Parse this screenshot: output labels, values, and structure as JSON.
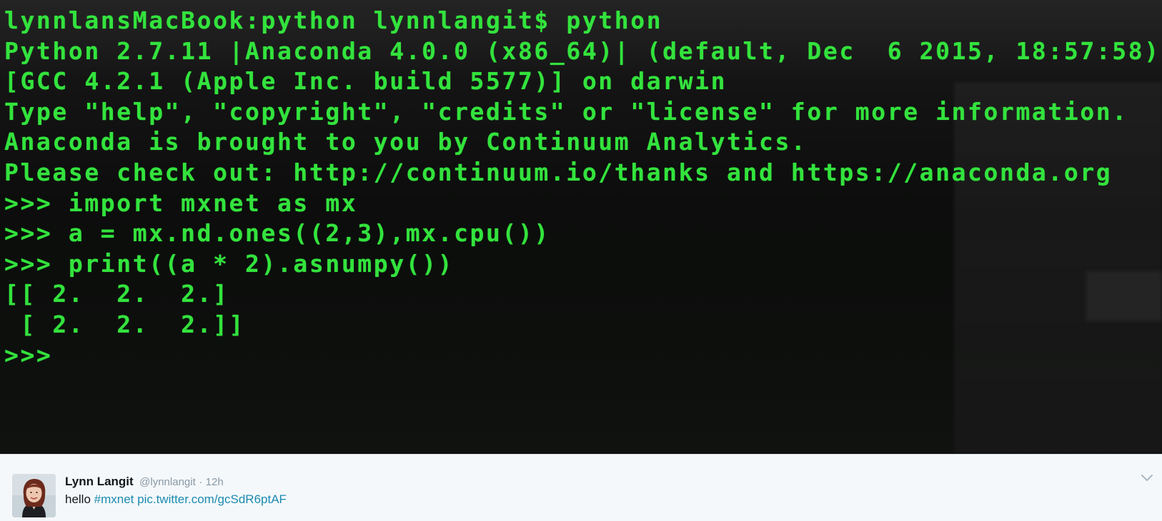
{
  "terminal": {
    "lines": [
      "lynnlansMacBook:python lynnlangit$ python",
      "Python 2.7.11 |Anaconda 4.0.0 (x86_64)| (default, Dec  6 2015, 18:57:58)",
      "[GCC 4.2.1 (Apple Inc. build 5577)] on darwin",
      "Type \"help\", \"copyright\", \"credits\" or \"license\" for more information.",
      "Anaconda is brought to you by Continuum Analytics.",
      "Please check out: http://continuum.io/thanks and https://anaconda.org",
      ">>> import mxnet as mx",
      ">>> a = mx.nd.ones((2,3),mx.cpu())",
      ">>> print((a * 2).asnumpy())",
      "[[ 2.  2.  2.]",
      " [ 2.  2.  2.]]",
      ">>>"
    ],
    "text_color": "#33e33d",
    "background": "#0c0d0c"
  },
  "tweet": {
    "author_name": "Lynn Langit",
    "author_handle": "@lynnlangit",
    "separator": "·",
    "time": "12h",
    "text_prefix": "hello ",
    "hashtag": "#mxnet",
    "link": "pic.twitter.com/gcSdR6ptAF",
    "link_color": "#1b8bb0",
    "avatar_icon": "user-avatar-photo",
    "menu_icon": "chevron-down-icon"
  }
}
